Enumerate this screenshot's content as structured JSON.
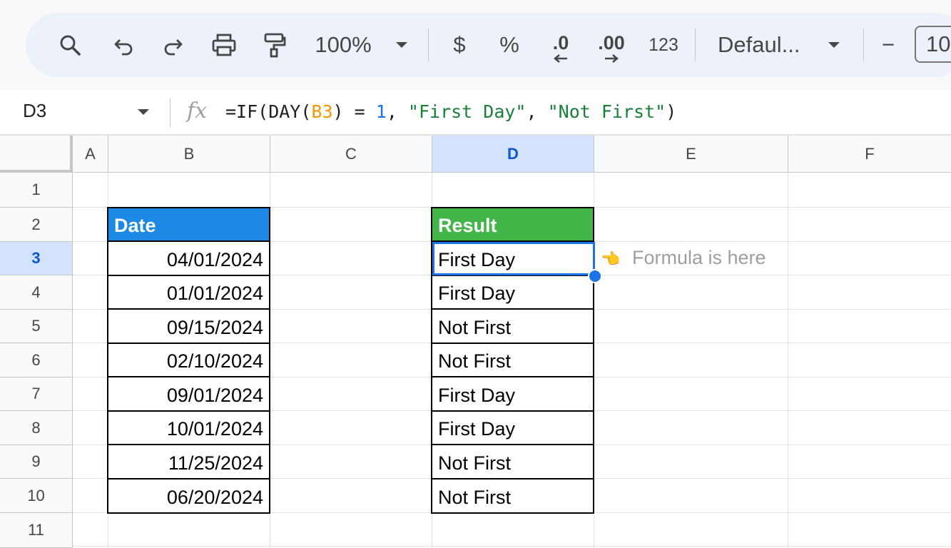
{
  "toolbar": {
    "zoom": "100%",
    "currency": "$",
    "percent": "%",
    "decrease_decimal": ".0",
    "increase_decimal": ".00",
    "number_format": "123",
    "font": "Defaul...",
    "font_size": "10",
    "minus": "−"
  },
  "formula_bar": {
    "name_box": "D3",
    "fx": "fx",
    "parts": {
      "p1": "=IF(DAY(",
      "ref": "B3",
      "p2": ") = ",
      "num": "1",
      "p3": ", ",
      "str1": "\"First Day\"",
      "p4": ", ",
      "str2": "\"Not First\"",
      "p5": ")"
    }
  },
  "columns": [
    "A",
    "B",
    "C",
    "D",
    "E",
    "F"
  ],
  "rows": [
    "1",
    "2",
    "3",
    "4",
    "5",
    "6",
    "7",
    "8",
    "9",
    "10",
    "11"
  ],
  "selected_column": "D",
  "selected_row": "3",
  "table": {
    "date_header": "Date",
    "result_header": "Result",
    "dates": [
      "04/01/2024",
      "01/01/2024",
      "09/15/2024",
      "02/10/2024",
      "09/01/2024",
      "10/01/2024",
      "11/25/2024",
      "06/20/2024"
    ],
    "results": [
      "First Day",
      "First Day",
      "Not First",
      "Not First",
      "First Day",
      "First Day",
      "Not First",
      "Not First"
    ]
  },
  "annotation": {
    "pointer": "👈",
    "text": "Formula is here"
  },
  "colors": {
    "date_header_bg": "#1e88e5",
    "result_header_bg": "#43b649",
    "selection": "#1a73e8"
  }
}
